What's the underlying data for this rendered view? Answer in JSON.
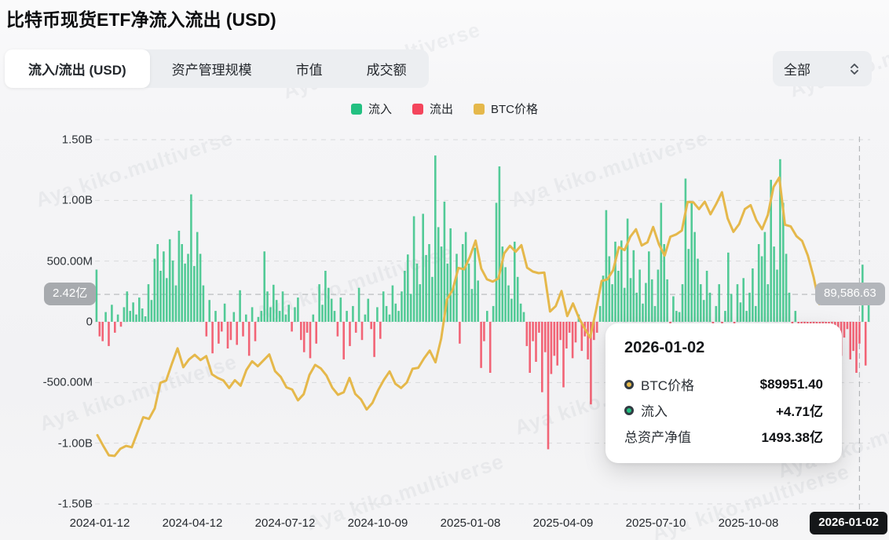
{
  "header": {
    "title": "比特币现货ETF净流入流出 (USD)"
  },
  "tabs": {
    "items": [
      {
        "label": "流入/流出 (USD)",
        "active": true
      },
      {
        "label": "资产管理规模",
        "active": false
      },
      {
        "label": "市值",
        "active": false
      },
      {
        "label": "成交额",
        "active": false
      }
    ]
  },
  "range_select": {
    "value": "全部",
    "icon": "updown-chevron-icon"
  },
  "legend": {
    "items": [
      {
        "label": "流入",
        "color": "#22c081"
      },
      {
        "label": "流出",
        "color": "#f4455c"
      },
      {
        "label": "BTC价格",
        "color": "#e5b84b"
      }
    ]
  },
  "watermark": {
    "text": "Aya kiko.multiverse"
  },
  "crosshair": {
    "flow_label": "2.42亿",
    "price_label": "89,586.63",
    "date_label": "2026-01-02"
  },
  "tooltip": {
    "title": "2026-01-02",
    "rows": [
      {
        "dot": "#e5b84b",
        "label": "BTC价格",
        "value": "$89951.40"
      },
      {
        "dot": "#22c081",
        "label": "流入",
        "value": "+4.71亿"
      },
      {
        "dot": "",
        "label": "总资产净值",
        "value": "1493.38亿"
      }
    ]
  },
  "chart_data": {
    "type": "bar+line",
    "title": "比特币现货ETF净流入流出 (USD)",
    "x_range": [
      "2024-01-11",
      "2026-01-02"
    ],
    "x_tick_labels": [
      "2024-01-12",
      "2024-04-12",
      "2024-07-12",
      "2024-10-09",
      "2025-01-08",
      "2025-04-09",
      "2025-07-10",
      "2025-10-08"
    ],
    "flow_axis": {
      "ticks": [
        {
          "label": "1.50B",
          "value": 1500
        },
        {
          "label": "1.00B",
          "value": 1000
        },
        {
          "label": "500.00M",
          "value": 500
        },
        {
          "label": "0",
          "value": 0
        },
        {
          "label": "-500.00M",
          "value": -500
        },
        {
          "label": "-1.00B",
          "value": -1000
        },
        {
          "label": "-1.50B",
          "value": -1500
        }
      ],
      "ylim_millions": [
        -1526,
        1526
      ]
    },
    "price_axis": {
      "ylim_usd": [
        24200,
        138100
      ],
      "visible": false
    },
    "grid": "dashed-horizontal",
    "legend_position": "top-center",
    "sampling_note": "daily bars approximated at ~3-day samples; line at ~5-day samples",
    "series": [
      {
        "name": "净流入/流出",
        "type": "bar",
        "unit": "millions_usd",
        "color_positive": "#45c78f",
        "color_negative": "#f2586c",
        "values": [
          430,
          -120,
          -160,
          80,
          -200,
          140,
          -90,
          60,
          -40,
          120,
          250,
          90,
          160,
          60,
          200,
          110,
          45,
          310,
          180,
          520,
          640,
          420,
          580,
          360,
          680,
          505,
          300,
          750,
          640,
          480,
          560,
          1050,
          460,
          740,
          560,
          300,
          -120,
          180,
          -260,
          90,
          -180,
          -80,
          150,
          -220,
          -150,
          80,
          -190,
          260,
          -120,
          60,
          -280,
          120,
          -160,
          40,
          90,
          580,
          250,
          120,
          305,
          180,
          90,
          250,
          60,
          140,
          -80,
          120,
          200,
          -150,
          -250,
          -90,
          -300,
          60,
          -180,
          310,
          140,
          420,
          280,
          190,
          90,
          -120,
          200,
          -310,
          90,
          -200,
          130,
          -90,
          280,
          -150,
          60,
          190,
          -60,
          -290,
          120,
          -140,
          250,
          130,
          60,
          300,
          150,
          90,
          250,
          420,
          555,
          230,
          870,
          480,
          310,
          890,
          550,
          640,
          370,
          1370,
          780,
          620,
          990,
          480,
          770,
          300,
          560,
          -180,
          640,
          740,
          480,
          270,
          610,
          340,
          -380,
          -160,
          90,
          -420,
          130,
          980,
          1280,
          620,
          450,
          300,
          190,
          660,
          370,
          150,
          80,
          -200,
          -420,
          -160,
          -330,
          -90,
          -580,
          -250,
          -1050,
          -430,
          -280,
          -360,
          -150,
          -540,
          -220,
          -90,
          -300,
          -170,
          60,
          -240,
          -120,
          -310,
          -680,
          -150,
          -90,
          130,
          380,
          920,
          540,
          310,
          660,
          420,
          670,
          280,
          850,
          360,
          590,
          240,
          430,
          150,
          320,
          580,
          350,
          130,
          430,
          980,
          640,
          350,
          -120,
          210,
          90,
          80,
          310,
          1180,
          600,
          980,
          740,
          520,
          310,
          180,
          420,
          240,
          -90,
          130,
          310,
          -180,
          90,
          570,
          230,
          -130,
          310,
          160,
          360,
          90,
          240,
          440,
          130,
          640,
          540,
          740,
          310,
          1170,
          620,
          430,
          1340,
          980,
          560,
          240,
          -150,
          90,
          -280,
          -320,
          -440,
          -180,
          -520,
          -240,
          -380,
          -120,
          -450,
          -220,
          -90,
          -160,
          -350,
          -90,
          -280,
          -130,
          -60,
          -310,
          -240,
          -420,
          -180,
          471,
          -360,
          150
        ]
      },
      {
        "name": "BTC价格",
        "type": "line",
        "unit": "usd",
        "color": "#e5b84b",
        "values": [
          46300,
          43100,
          40100,
          39900,
          42100,
          43000,
          42600,
          47200,
          51800,
          51300,
          54500,
          62400,
          63100,
          68300,
          73000,
          67200,
          69600,
          71000,
          69400,
          70600,
          65000,
          63900,
          63100,
          60800,
          63200,
          61500,
          66300,
          69000,
          67500,
          69300,
          71100,
          66000,
          64200,
          61000,
          60300,
          57000,
          58900,
          64800,
          67900,
          66800,
          64600,
          60900,
          58700,
          59500,
          63900,
          59000,
          57300,
          54200,
          56200,
          60100,
          63300,
          65900,
          62100,
          60800,
          62500,
          66700,
          67000,
          69900,
          72300,
          68700,
          76000,
          88000,
          91000,
          97700,
          97300,
          101100,
          106100,
          97500,
          94200,
          93500,
          94500,
          102200,
          104500,
          102700,
          104700,
          97800,
          96600,
          96100,
          96300,
          84300,
          86000,
          90600,
          82900,
          86800,
          82500,
          79200,
          76300,
          84500,
          93700,
          94200,
          97000,
          104100,
          103200,
          107300,
          109600,
          104600,
          105600,
          110300,
          105000,
          101500,
          107300,
          108000,
          109200,
          118000,
          117900,
          115800,
          118100,
          114200,
          117400,
          121000,
          112900,
          108800,
          111200,
          115800,
          117000,
          112400,
          109600,
          114000,
          122600,
          125500,
          111000,
          110500,
          107500,
          106000,
          101500,
          94900,
          86600,
          91300,
          90500,
          87300,
          88600,
          87200,
          89300,
          89951
        ]
      }
    ],
    "crosshair_index": 250,
    "crosshair_values": {
      "date": "2026-01-02",
      "btc_price_usd": 89951.4,
      "inflow": "+4.71亿",
      "total_net_assets": "1493.38亿",
      "y_flow_label": "2.42亿",
      "y_price_label": "89,586.63"
    }
  }
}
